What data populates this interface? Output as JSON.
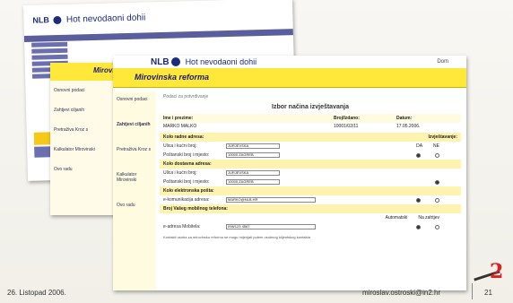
{
  "back_shot": {
    "logo": "NLB",
    "portal_title": "Hot nevodaoni dohii"
  },
  "middle_shot": {
    "title": "Mirovinska",
    "nav": [
      "Osnovni podaci",
      "Zahtjevi ciljanih",
      "Pretraživa Kroz s",
      "Kalkulator Mirovinski",
      "Ovo radu"
    ]
  },
  "front_shot": {
    "logo": "NLB",
    "portal_title": "Hot nevodaoni dohii",
    "user": "Dom",
    "title": "Mirovinska reforma",
    "nav": [
      "Osnovni podaci",
      "Zahtjevi ciljanih",
      "Pretraživa Kroz s",
      "Kalkulator Mirovinski",
      "Ovo radu"
    ],
    "crumb": "Podaci za potvrđivanje",
    "form_title": "Izbor načina izvještavanja",
    "header": {
      "ime_label": "Ime i prezime:",
      "broj_label": "Broj/Izdano:",
      "datum_label": "Datum:"
    },
    "values": {
      "name": "MARKO MALKO",
      "number": "10001/02/11",
      "date": "17.05.2006."
    },
    "sections": {
      "adresa": "Kolo radne adresa:",
      "izvjestavanje": "Izvještavanje:",
      "dostavna": "Kolo dostavna adresa:",
      "elektronska": "Kolo elektronska pošta:",
      "mobilni": "Broj Vašeg mobilnog telefona:"
    },
    "fields": {
      "ulica_label": "Ulica i kućni broj:",
      "ulica_val": "JURJEVSKA",
      "posta_label": "Poštanski broj i mjesto:",
      "posta_val": "10000 ZAGREB",
      "ulica2_val": "JURJEVSKA",
      "posta2_val": "10000 ZAGREB",
      "email_label": "e-komunikacija adresa:",
      "email_val": "MARKO@NLB.HR",
      "mobile_label": "e-adresa Mobitela:",
      "mobile_val": "098/123 4567"
    },
    "options": {
      "da": "DA",
      "ne": "NE",
      "auto": "Automatski",
      "request": "Na zahtjev"
    },
    "note": "Kontakti osoba za mirovinsku reformu se mogu mijenjati putem osobnog klijentskog kontakta"
  },
  "footer": {
    "date": "26. Listopad 2006.",
    "email": "miroslav.ostroski@in2.hr",
    "page": "21"
  },
  "brand": {
    "mark": "2"
  }
}
